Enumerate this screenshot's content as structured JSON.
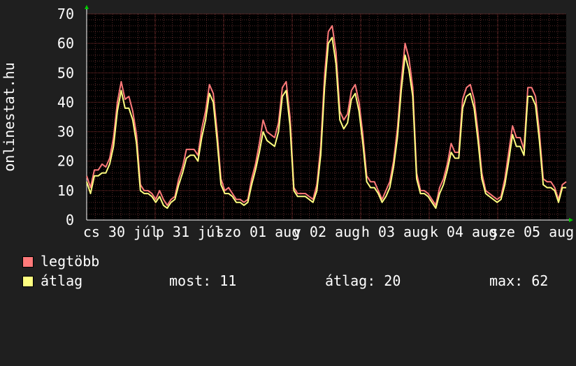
{
  "chart_data": {
    "type": "line",
    "ylabel": "onlinestat.hu",
    "ylim": [
      0,
      70
    ],
    "yticks": [
      0,
      10,
      20,
      30,
      40,
      50,
      60,
      70
    ],
    "x_tick_labels": [
      "cs 30 júl",
      "p 31 júl",
      "szo 01 aug",
      "v 02 aug",
      "h 03 aug",
      "k 04 aug",
      "sze 05 aug"
    ],
    "grid": true,
    "colors": {
      "background": "#1f1f1f",
      "plot_bg": "#000000",
      "grid": "#5a2a2a",
      "axis": "#ffffff",
      "arrow": "#00cc00"
    },
    "series": [
      {
        "name": "legtöbb",
        "color": "#ff7a7a",
        "values": [
          15,
          11,
          17,
          17,
          19,
          18,
          21,
          28,
          40,
          47,
          41,
          42,
          37,
          29,
          12,
          10,
          10,
          9,
          7,
          10,
          7,
          5,
          7,
          8,
          14,
          18,
          24,
          24,
          24,
          22,
          31,
          37,
          46,
          43,
          30,
          14,
          10,
          11,
          9,
          7,
          7,
          6,
          7,
          14,
          19,
          26,
          34,
          30,
          29,
          28,
          33,
          45,
          47,
          35,
          11,
          9,
          9,
          9,
          8,
          7,
          12,
          25,
          49,
          64,
          66,
          57,
          37,
          34,
          36,
          44,
          46,
          40,
          29,
          15,
          13,
          13,
          10,
          7,
          10,
          13,
          20,
          31,
          47,
          60,
          55,
          45,
          16,
          10,
          10,
          9,
          7,
          5,
          11,
          14,
          19,
          26,
          23,
          23,
          41,
          45,
          46,
          41,
          30,
          16,
          10,
          9,
          8,
          7,
          8,
          14,
          23,
          32,
          28,
          28,
          24,
          45,
          45,
          42,
          30,
          14,
          13,
          13,
          11,
          7,
          12,
          13
        ]
      },
      {
        "name": "átlag",
        "color": "#ffff80",
        "values": [
          13,
          9,
          15,
          15,
          16,
          16,
          19,
          25,
          37,
          44,
          38,
          38,
          34,
          26,
          10,
          9,
          9,
          8,
          6,
          8,
          5,
          4,
          6,
          7,
          12,
          16,
          21,
          22,
          22,
          20,
          28,
          34,
          43,
          40,
          27,
          12,
          9,
          9,
          8,
          6,
          6,
          5,
          6,
          12,
          17,
          23,
          30,
          27,
          26,
          25,
          30,
          42,
          44,
          32,
          10,
          8,
          8,
          8,
          7,
          6,
          10,
          22,
          45,
          60,
          62,
          53,
          34,
          31,
          33,
          41,
          43,
          37,
          26,
          13,
          11,
          11,
          9,
          6,
          8,
          11,
          18,
          28,
          44,
          56,
          51,
          42,
          14,
          9,
          9,
          8,
          6,
          4,
          9,
          12,
          17,
          23,
          21,
          21,
          38,
          42,
          43,
          38,
          27,
          14,
          9,
          8,
          7,
          6,
          7,
          12,
          20,
          29,
          25,
          25,
          22,
          42,
          42,
          39,
          27,
          12,
          11,
          11,
          10,
          6,
          11,
          11
        ]
      }
    ]
  },
  "legend": [
    {
      "label": "legtöbb",
      "color": "#ff7a7a"
    },
    {
      "label": "átlag",
      "color": "#ffff80"
    }
  ],
  "stats": {
    "most_label": "most:",
    "most_value": "11",
    "atlag_label": "átlag:",
    "atlag_value": "20",
    "max_label": "max:",
    "max_value": "62"
  }
}
